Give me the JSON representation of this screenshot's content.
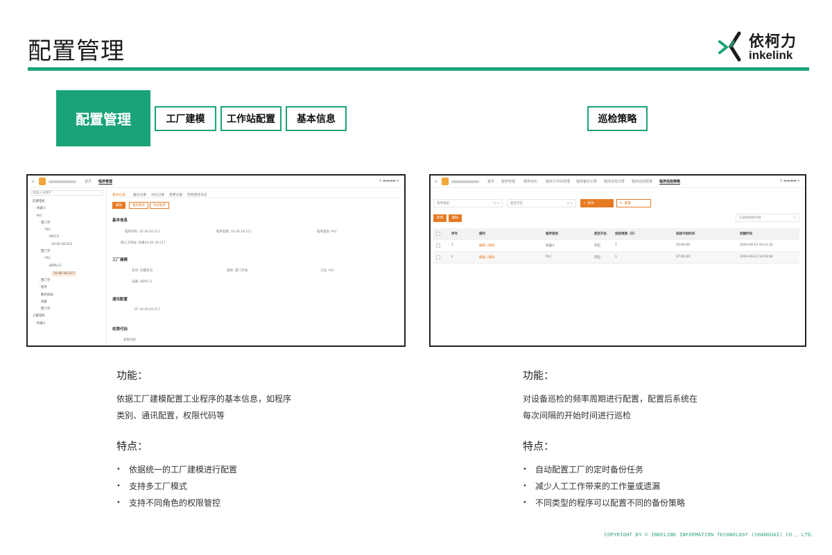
{
  "page_title": "配置管理",
  "brand": {
    "name_cn": "依柯力",
    "name_en": "inkelink",
    "accent": "#1aa37a"
  },
  "modules": {
    "main": "配置管理",
    "items": [
      "工厂建模",
      "工作站配置",
      "基本信息"
    ],
    "right": "巡检策略"
  },
  "left_shot": {
    "nav_tabs": [
      "首页",
      "程序管理"
    ],
    "search_placeholder": "请输入关键字",
    "tree": [
      "· 信捷电机",
      "· 机器人",
      "· PLC",
      "· 西门子",
      "· PLC",
      "· 0PLC2",
      "10.40.18.215",
      "· 西门子",
      "· PLC",
      "· 8DPLC1",
      "10.40.18.217",
      "· 西门子",
      "· 程序",
      "· 数控机床",
      "· 伺服",
      "· 西门子",
      "· 三菱电机",
      "· 机器人"
    ],
    "tree_selected_index": 10,
    "sub_tabs": [
      "基本信息",
      "备份记录",
      "对比记录",
      "变更记录",
      "巡检操作日志"
    ],
    "buttons": [
      "删除",
      "备份程序",
      "对比程序"
    ],
    "sections": {
      "basic": "基本信息",
      "factory": "工厂建模",
      "comm": "通讯配置",
      "perm": "权限代码"
    },
    "fields": {
      "program_code": "程序代码: 10.40.18.217",
      "program_name": "程序名称: 10.40.18.217",
      "program_type": "程序类别: PLC",
      "workstation": "默认工作站: 信捷10.40.18.217",
      "workshop": "车间: 信捷车间",
      "line": "线体: 西门子线",
      "process": "工位: PLC",
      "device": "设备: 8DPLC1",
      "ip": "IP: 10.40.18.217",
      "perm_code": "权限代码"
    }
  },
  "right_shot": {
    "nav_tabs": [
      "首页",
      "程序管理",
      "程序对比",
      "程序工作站管理",
      "程序备份记录",
      "程序巡检记录",
      "程序巡检配置",
      "程序巡检策略"
    ],
    "select_type": "程序类型",
    "select_enable": "是否开启",
    "query": "查询",
    "reset": "重置",
    "add": "新增",
    "delete": "删除",
    "batch_select": "已选择项目计划",
    "columns": [
      "序号",
      "操作",
      "程序类别",
      "是否开启",
      "巡检周期（天）",
      "巡检开始时间",
      "创建时间"
    ],
    "rows": [
      {
        "no": "1",
        "ops": "编辑 | 删除",
        "category": "机器人",
        "enabled": "开启",
        "cycle": "1",
        "start": "10:00:00",
        "created": "2024-09-23 10:21:32"
      },
      {
        "no": "2",
        "ops": "编辑 | 删除",
        "category": "PLC",
        "enabled": "开启",
        "cycle": "1",
        "start": "07:00:00",
        "created": "2024-09-23 10:09:04"
      }
    ]
  },
  "desc_left": {
    "func_title": "功能：",
    "func_text": [
      "依据工厂建模配置工业程序的基本信息，如程序",
      "类别、通讯配置，权限代码等"
    ],
    "feat_title": "特点：",
    "features": [
      "依据统一的工厂建模进行配置",
      "支持多工厂模式",
      "支持不同角色的权限管控"
    ]
  },
  "desc_right": {
    "func_title": "功能：",
    "func_text": [
      "对设备巡检的频率周期进行配置，配置后系统在",
      "每次间隔的开始时间进行巡检"
    ],
    "feat_title": "特点：",
    "features": [
      "自动配置工厂的定时备份任务",
      "减少人工工作带来的工作量或遗漏",
      "不同类型的程序可以配置不同的备份策略"
    ]
  },
  "copyright": "COPYRIGHT BY © INKELINK INFORMATION TECHNOLOGY (SHANGHAI) CO., LTD."
}
